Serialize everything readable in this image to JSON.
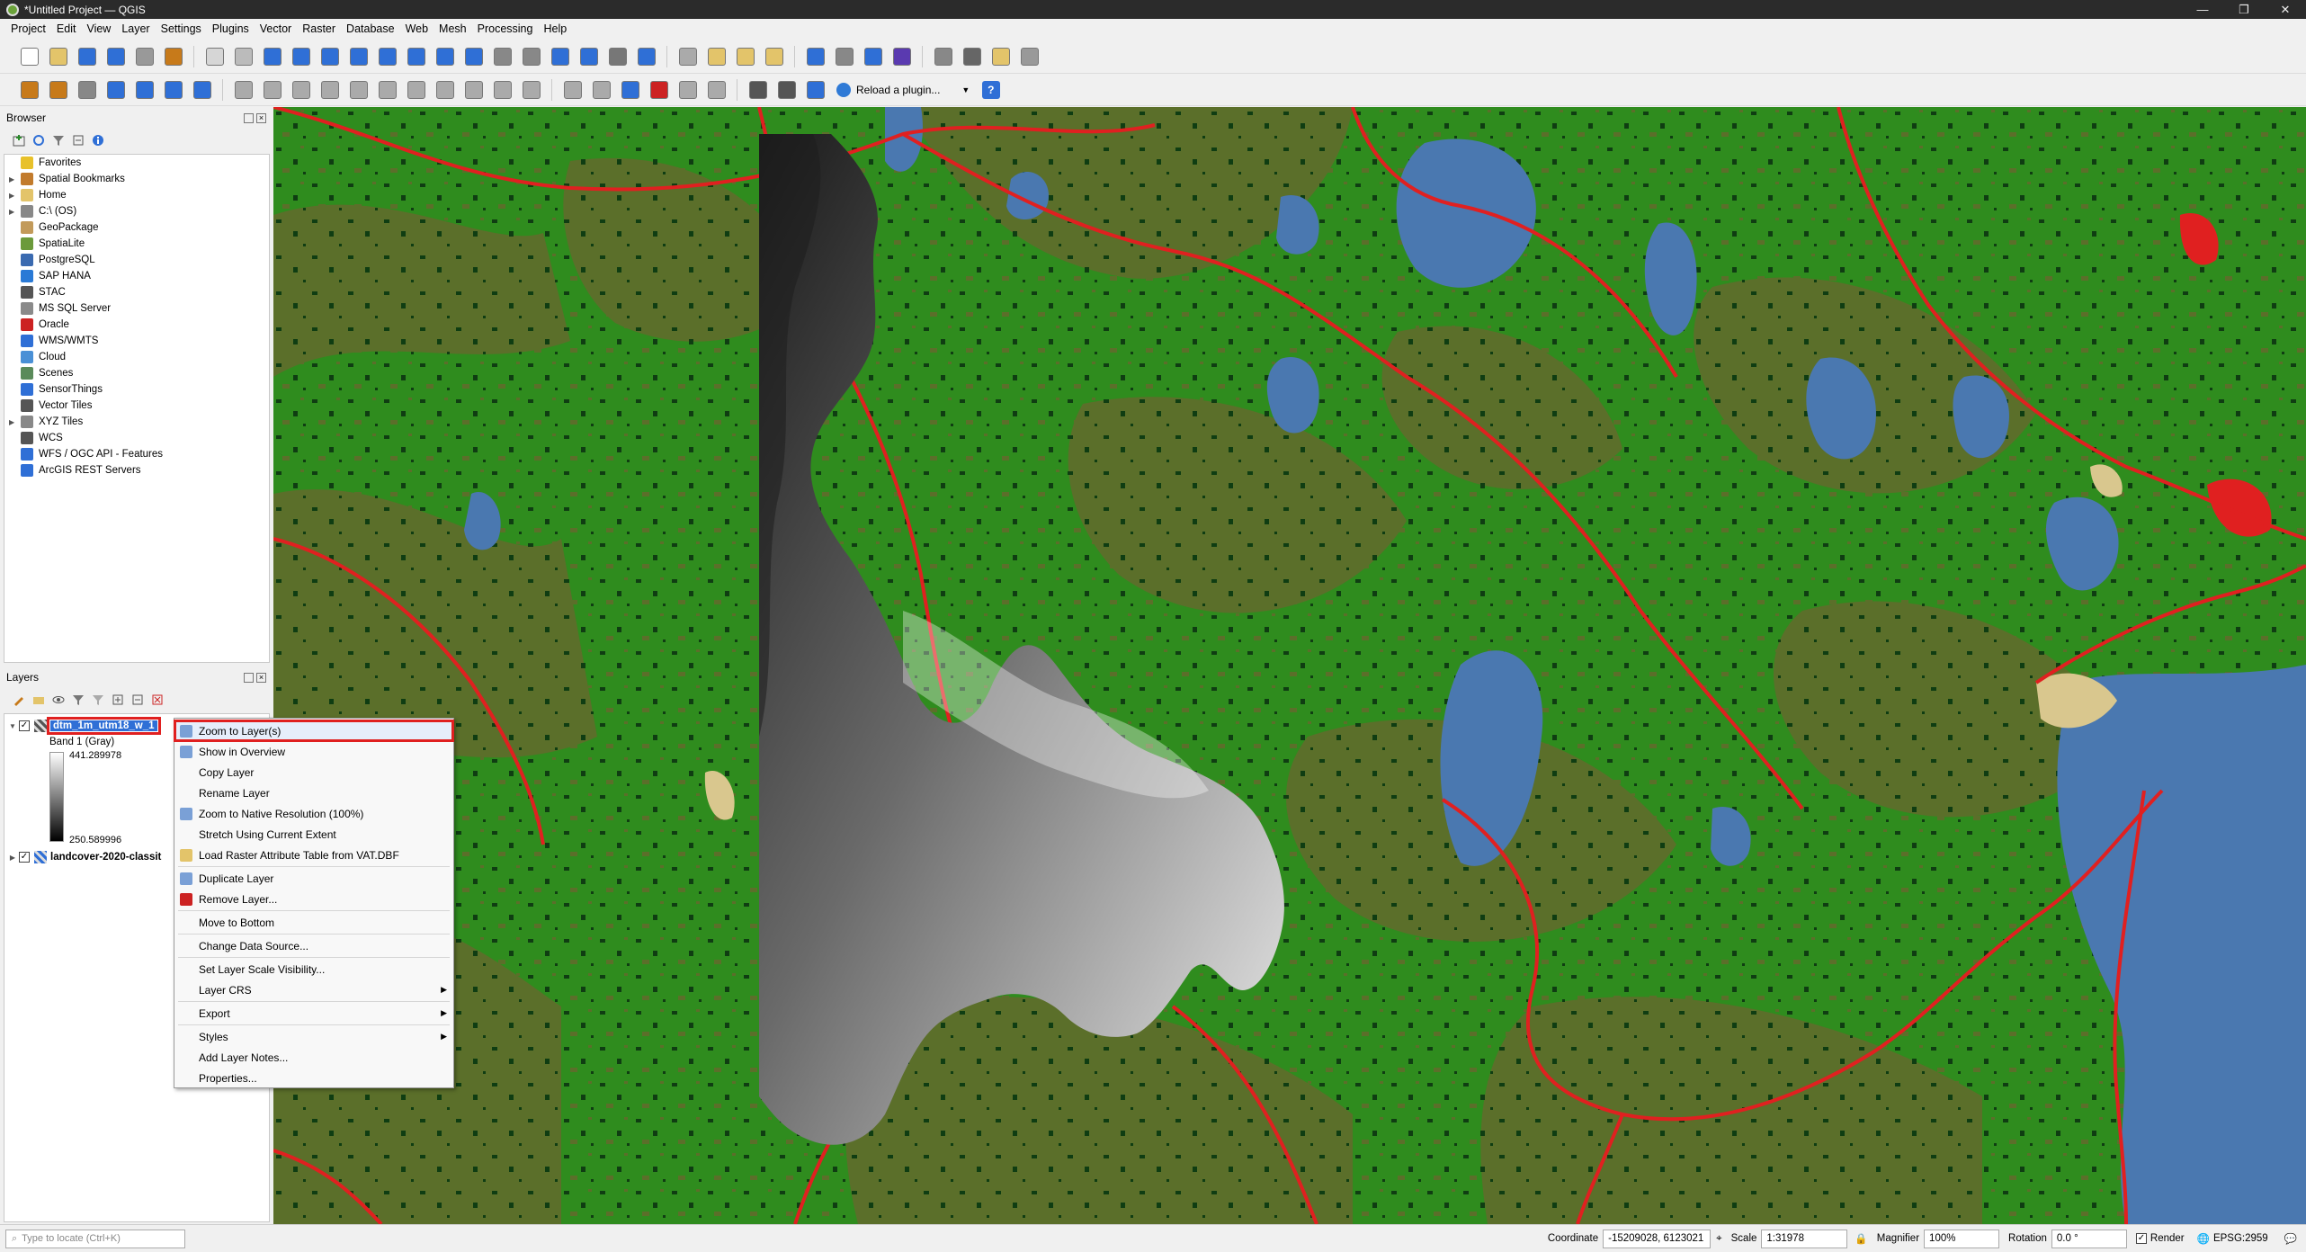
{
  "window": {
    "title": "*Untitled Project — QGIS",
    "minimize": "—",
    "maximize": "❐",
    "close": "✕"
  },
  "menubar": {
    "items": [
      "Project",
      "Edit",
      "View",
      "Layer",
      "Settings",
      "Plugins",
      "Vector",
      "Raster",
      "Database",
      "Web",
      "Mesh",
      "Processing",
      "Help"
    ]
  },
  "toolbar2": {
    "reload_plugin_label": "Reload a plugin..."
  },
  "browser": {
    "title": "Browser",
    "items": [
      {
        "label": "Favorites",
        "icon": "star-icon"
      },
      {
        "label": "Spatial Bookmarks",
        "icon": "bookmark-icon"
      },
      {
        "label": "Home",
        "icon": "folder-icon"
      },
      {
        "label": "C:\\ (OS)",
        "icon": "drive-icon"
      },
      {
        "label": "GeoPackage",
        "icon": "geopackage-icon"
      },
      {
        "label": "SpatiaLite",
        "icon": "spatialite-icon"
      },
      {
        "label": "PostgreSQL",
        "icon": "postgresql-icon"
      },
      {
        "label": "SAP HANA",
        "icon": "sap-hana-icon"
      },
      {
        "label": "STAC",
        "icon": "stac-icon"
      },
      {
        "label": "MS SQL Server",
        "icon": "mssql-icon"
      },
      {
        "label": "Oracle",
        "icon": "oracle-icon"
      },
      {
        "label": "WMS/WMTS",
        "icon": "wms-icon"
      },
      {
        "label": "Cloud",
        "icon": "cloud-icon"
      },
      {
        "label": "Scenes",
        "icon": "scenes-icon"
      },
      {
        "label": "SensorThings",
        "icon": "sensorthings-icon"
      },
      {
        "label": "Vector Tiles",
        "icon": "vector-tiles-icon"
      },
      {
        "label": "XYZ Tiles",
        "icon": "xyz-tiles-icon"
      },
      {
        "label": "WCS",
        "icon": "wcs-icon"
      },
      {
        "label": "WFS / OGC API - Features",
        "icon": "wfs-icon"
      },
      {
        "label": "ArcGIS REST Servers",
        "icon": "arcgis-icon"
      }
    ]
  },
  "layers": {
    "title": "Layers",
    "layer1": {
      "name": "dtm_1m_utm18_w_1",
      "band": "Band 1 (Gray)",
      "max": "441.289978",
      "min": "250.589996"
    },
    "layer2": {
      "name": "landcover-2020-classit"
    }
  },
  "context_menu": {
    "items": [
      {
        "label": "Zoom to Layer(s)",
        "icon": "zoom-layer-icon",
        "highlight": true
      },
      {
        "label": "Show in Overview",
        "icon": "overview-icon"
      },
      {
        "label": "Copy Layer"
      },
      {
        "label": "Rename Layer"
      },
      {
        "label": "Zoom to Native Resolution (100%)",
        "icon": "zoom-native-icon"
      },
      {
        "label": "Stretch Using Current Extent"
      },
      {
        "label": "Load Raster Attribute Table from VAT.DBF",
        "icon": "table-icon"
      },
      {
        "sep": true
      },
      {
        "label": "Duplicate Layer",
        "icon": "duplicate-icon"
      },
      {
        "label": "Remove Layer...",
        "icon": "remove-icon"
      },
      {
        "sep": true
      },
      {
        "label": "Move to Bottom"
      },
      {
        "sep": true
      },
      {
        "label": "Change Data Source..."
      },
      {
        "sep": true
      },
      {
        "label": "Set Layer Scale Visibility..."
      },
      {
        "label": "Layer CRS",
        "submenu": true
      },
      {
        "sep": true
      },
      {
        "label": "Export",
        "submenu": true
      },
      {
        "sep": true
      },
      {
        "label": "Styles",
        "submenu": true
      },
      {
        "label": "Add Layer Notes..."
      },
      {
        "label": "Properties..."
      }
    ]
  },
  "statusbar": {
    "locate_placeholder": "Type to locate (Ctrl+K)",
    "coordinate_label": "Coordinate",
    "coordinate_value": "-15209028, 6123021",
    "scale_label": "Scale",
    "scale_value": "1:31978",
    "magnifier_label": "Magnifier",
    "magnifier_value": "100%",
    "rotation_label": "Rotation",
    "rotation_value": "0.0 °",
    "render_label": "Render",
    "crs": "EPSG:2959"
  },
  "colors": {
    "forest": "#2f8c1e",
    "olive": "#5b6f2a",
    "water": "#4a78b0",
    "road": "#e02020",
    "selection": "#2f6fd6"
  }
}
